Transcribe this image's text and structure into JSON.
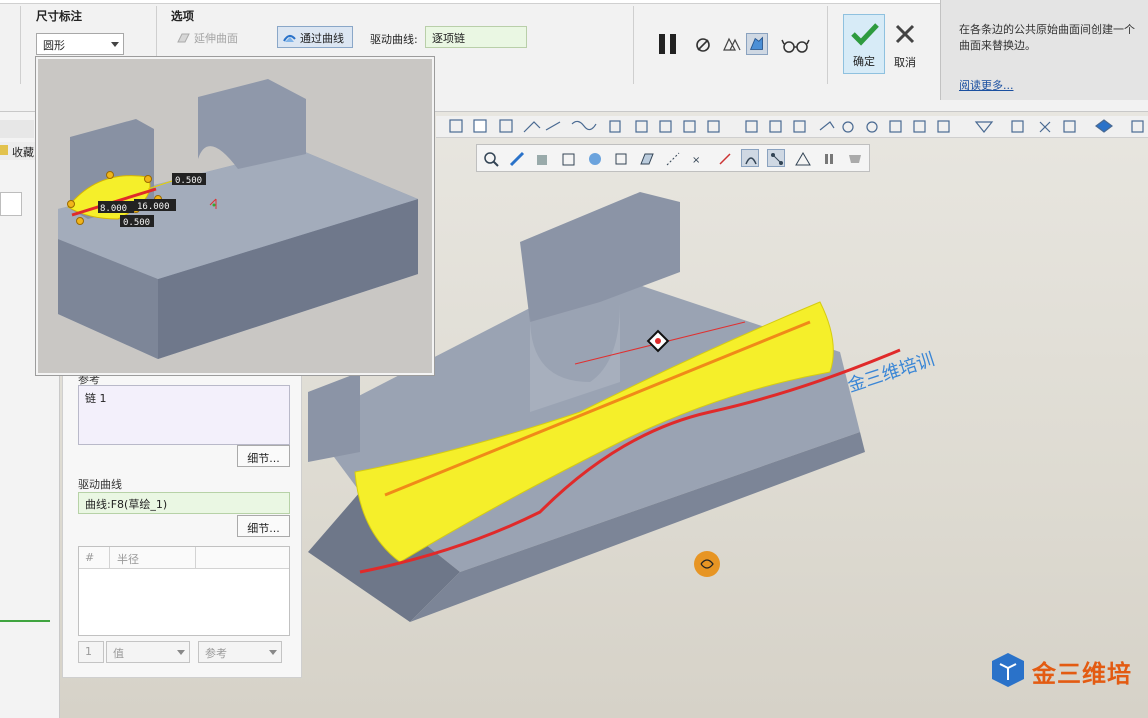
{
  "ribbon": {
    "dimension_group": {
      "title": "尺寸标注",
      "shape_value": "圆形"
    },
    "options_group": {
      "title": "选项",
      "extend_surface_label": "延伸曲面",
      "through_curve_label": "通过曲线",
      "driving_curve_label": "驱动曲线:",
      "driving_curve_value": "逐项链"
    },
    "actions": {
      "ok_label": "确定",
      "cancel_label": "取消"
    }
  },
  "help": {
    "text_line1": "在各条边的公共原始曲面间创建一个",
    "text_line2": "曲面来替换边。",
    "read_more": "阅读更多..."
  },
  "left_strip": {
    "favorites_label": "收藏"
  },
  "panel": {
    "reference_label": "参考",
    "reference_items": [
      "链 1"
    ],
    "details_button_1": "细节...",
    "driving_curve_label": "驱动曲线",
    "driving_curve_value": "曲线:F8(草绘_1)",
    "details_button_2": "细节...",
    "table": {
      "columns": [
        "#",
        "半径",
        ""
      ],
      "footer_index": "1",
      "value_placeholder": "值",
      "reference_placeholder": "参考"
    }
  },
  "inset": {
    "dim_labels": [
      "8.000",
      "16.000",
      "8.000",
      "0.500"
    ]
  },
  "viewport": {
    "watermark_brand": "金三维培",
    "model_text": "金三维培训"
  },
  "colors": {
    "accent": "#2a8fe0",
    "surface_yellow": "#f5ef2a",
    "curve_red": "#e02a2a",
    "model_gray": "#8a94a8",
    "ok_green": "#2e9b3f"
  }
}
